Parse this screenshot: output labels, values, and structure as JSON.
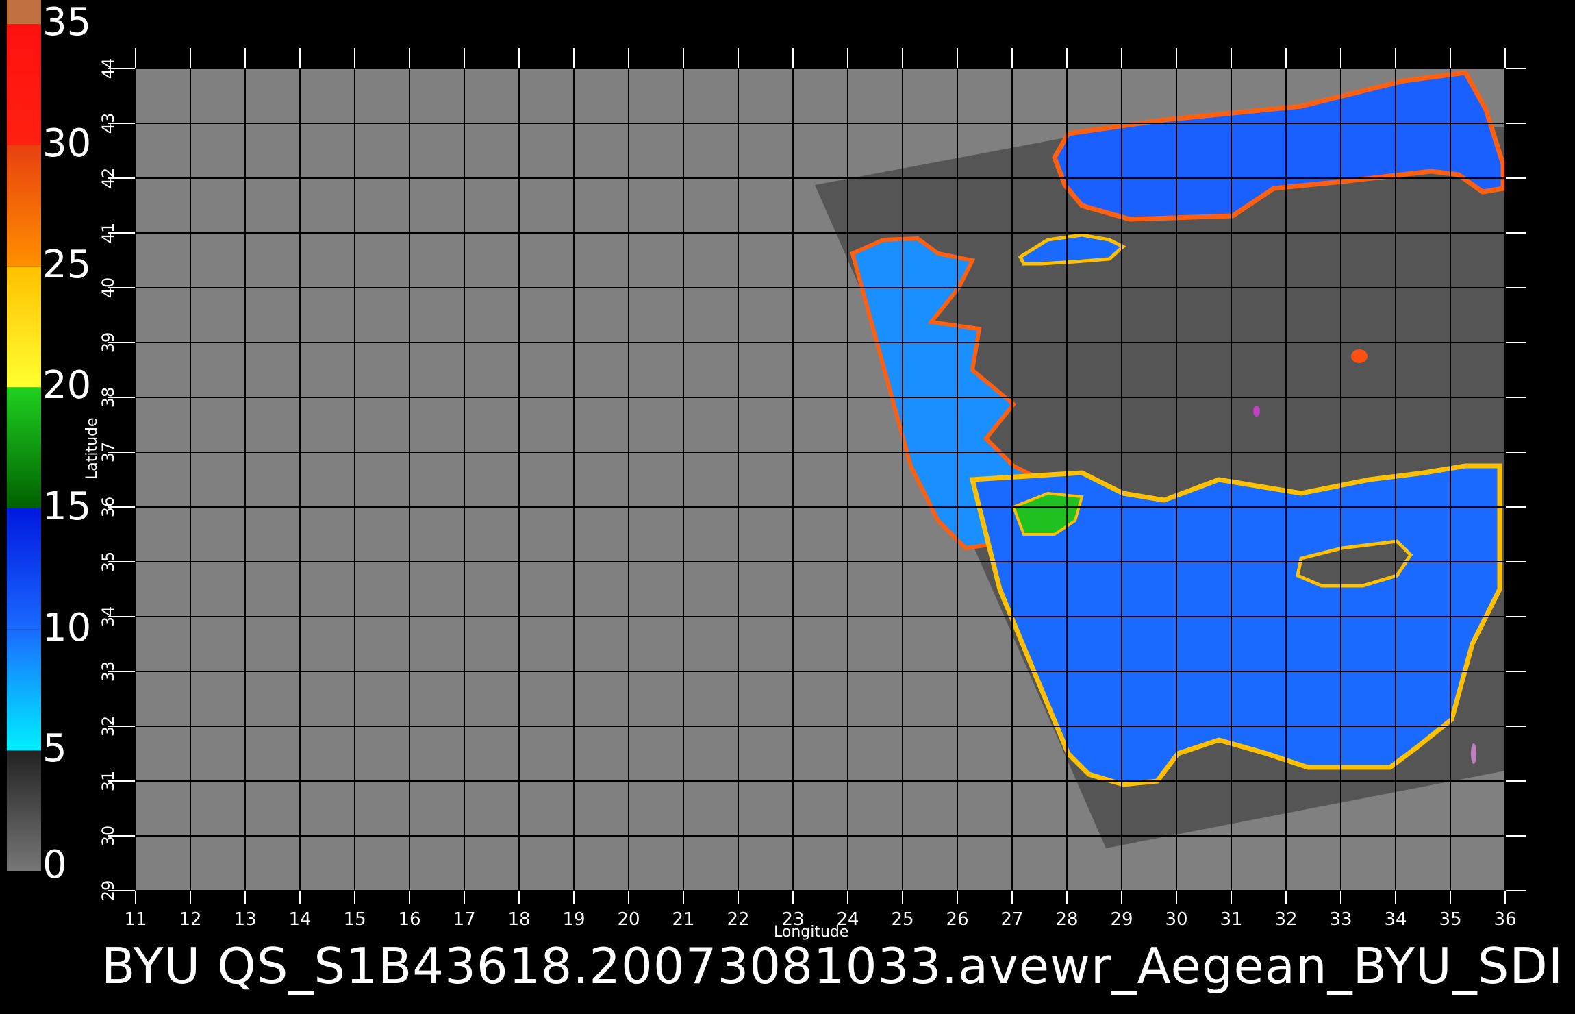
{
  "colorbar": {
    "ticks": [
      "0",
      "5",
      "10",
      "15",
      "20",
      "25",
      "30",
      "35"
    ],
    "segments": [
      {
        "from": 0,
        "to": 5,
        "colors": [
          "#777777",
          "#222222"
        ]
      },
      {
        "from": 5,
        "to": 10,
        "colors": [
          "#00f0ff",
          "#1a6aff"
        ]
      },
      {
        "from": 10,
        "to": 15,
        "colors": [
          "#1a6aff",
          "#0018e0"
        ]
      },
      {
        "from": 15,
        "to": 20,
        "colors": [
          "#006000",
          "#20d020"
        ]
      },
      {
        "from": 20,
        "to": 25,
        "colors": [
          "#ffff30",
          "#ffc000"
        ]
      },
      {
        "from": 25,
        "to": 30,
        "colors": [
          "#ff9000",
          "#e84010"
        ]
      },
      {
        "from": 30,
        "to": 35,
        "colors": [
          "#ff2010",
          "#ff1010"
        ]
      },
      {
        "from": 35,
        "to": 36,
        "colors": [
          "#c07040",
          "#c07040"
        ]
      }
    ]
  },
  "map": {
    "lon_ticks": [
      "11",
      "12",
      "13",
      "14",
      "15",
      "16",
      "17",
      "18",
      "19",
      "20",
      "21",
      "22",
      "23",
      "24",
      "25",
      "26",
      "27",
      "28",
      "29",
      "30",
      "31",
      "32",
      "33",
      "34",
      "35",
      "36"
    ],
    "lat_ticks": [
      "29",
      "30",
      "31",
      "32",
      "33",
      "34",
      "35",
      "36",
      "37",
      "38",
      "39",
      "40",
      "41",
      "42",
      "43",
      "44"
    ],
    "lon_range": [
      11,
      36
    ],
    "lat_range": [
      29,
      44
    ],
    "xlabel": "Longitude",
    "ylabel": "Latitude",
    "colors": {
      "background": "#808080",
      "swath": "#555555",
      "land": "#3a3a3a",
      "grid": "#000000",
      "ocean_low": "#1a8fff",
      "ocean_high": "#1030f0",
      "coast": [
        "#ffff30",
        "#ff6010",
        "#d02020"
      ]
    }
  },
  "footer": {
    "title": "BYU  QS_S1B43618.20073081033.avewr_Aegean_BYU_SDI"
  }
}
